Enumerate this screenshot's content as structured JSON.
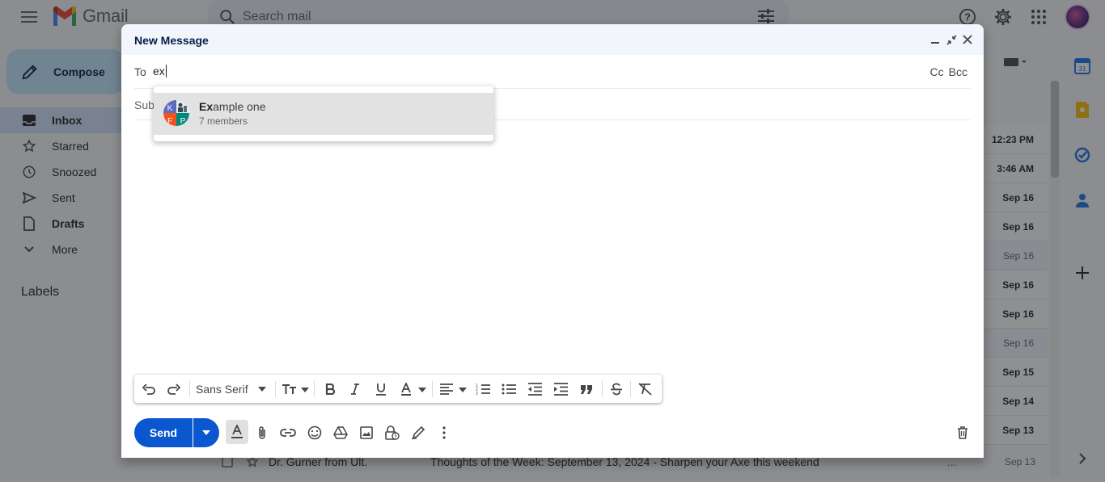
{
  "app": {
    "name": "Gmail"
  },
  "search": {
    "placeholder": "Search mail"
  },
  "compose_button": {
    "label": "Compose"
  },
  "nav": {
    "items": [
      {
        "label": "Inbox",
        "icon": "inbox-icon",
        "active": true
      },
      {
        "label": "Starred",
        "icon": "star-icon"
      },
      {
        "label": "Snoozed",
        "icon": "clock-icon"
      },
      {
        "label": "Sent",
        "icon": "send-icon"
      },
      {
        "label": "Drafts",
        "icon": "draft-icon",
        "bold": true
      },
      {
        "label": "More",
        "icon": "chevron-down-icon"
      }
    ],
    "labels_heading": "Labels"
  },
  "mail_dates": [
    {
      "date": "12:23 PM",
      "unread": true
    },
    {
      "date": "3:46 AM",
      "unread": true
    },
    {
      "date": "Sep 16",
      "unread": true
    },
    {
      "date": "Sep 16",
      "unread": true
    },
    {
      "date": "Sep 16",
      "unread": false
    },
    {
      "date": "Sep 16",
      "unread": true
    },
    {
      "date": "Sep 16",
      "unread": true
    },
    {
      "date": "Sep 16",
      "unread": false
    },
    {
      "date": "Sep 15",
      "unread": true
    },
    {
      "date": "Sep 14",
      "unread": true
    },
    {
      "date": "Sep 13",
      "unread": true
    }
  ],
  "bottom_row": {
    "sender": "Dr. Gurner from Ult.",
    "subject": "Thoughts of the Week: September 13, 2024 - Sharpen your Axe this weekend",
    "ellipsis": "...",
    "date": "Sep 13"
  },
  "compose": {
    "title": "New Message",
    "to_label": "To",
    "to_value": "ex",
    "cc_label": "Cc",
    "bcc_label": "Bcc",
    "subject_placeholder": "Sub",
    "suggestion": {
      "name_match": "Ex",
      "name_rest": "ample one",
      "subtitle": "7 members",
      "avatar_letters": [
        "K",
        "F",
        "P"
      ]
    },
    "font_name": "Sans Serif",
    "send_label": "Send"
  },
  "colors": {
    "send_blue": "#0b57d0",
    "compose_bg": "#c2e7ff",
    "active_nav": "#d3e3fd",
    "header_bg": "#f2f6fc"
  }
}
